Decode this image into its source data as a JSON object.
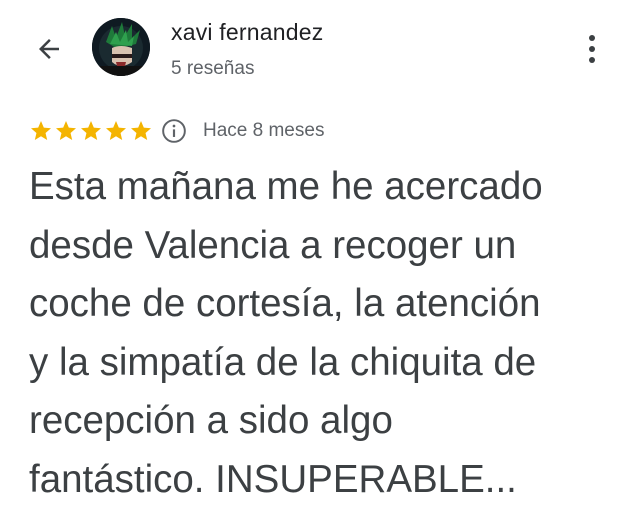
{
  "header": {
    "back_icon": "arrow-back-icon",
    "reviewer_name": "xavi fernandez",
    "review_count": "5 reseñas",
    "more_icon": "more-vert-icon"
  },
  "review": {
    "rating": 5,
    "rating_max": 5,
    "star_color": "#f4b400",
    "info_icon": "info-icon",
    "time_ago": "Hace 8 meses",
    "text": "Esta mañana me he acercado\ndesde Valencia a recoger un\ncoche de cortesía, la atención\ny la simpatía de la chiquita de\nrecepción a sido algo\nfantástico. INSUPERABLE..."
  }
}
